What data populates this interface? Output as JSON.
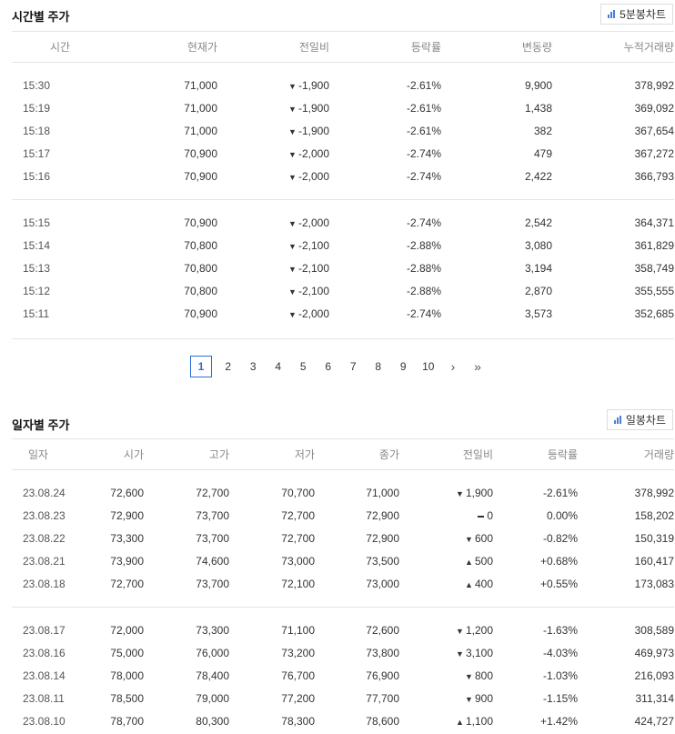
{
  "hourly": {
    "title": "시간별 주가",
    "chart_button": "5분봉차트",
    "columns": [
      "시간",
      "현재가",
      "전일비",
      "등락률",
      "변동량",
      "누적거래량"
    ],
    "group1": [
      {
        "time": "15:30",
        "price": "71,000",
        "dir": "down",
        "change": "-1,900",
        "rate": "-2.61%",
        "volume": "9,900",
        "cum": "378,992"
      },
      {
        "time": "15:19",
        "price": "71,000",
        "dir": "down",
        "change": "-1,900",
        "rate": "-2.61%",
        "volume": "1,438",
        "cum": "369,092"
      },
      {
        "time": "15:18",
        "price": "71,000",
        "dir": "down",
        "change": "-1,900",
        "rate": "-2.61%",
        "volume": "382",
        "cum": "367,654"
      },
      {
        "time": "15:17",
        "price": "70,900",
        "dir": "down",
        "change": "-2,000",
        "rate": "-2.74%",
        "volume": "479",
        "cum": "367,272"
      },
      {
        "time": "15:16",
        "price": "70,900",
        "dir": "down",
        "change": "-2,000",
        "rate": "-2.74%",
        "volume": "2,422",
        "cum": "366,793"
      }
    ],
    "group2": [
      {
        "time": "15:15",
        "price": "70,900",
        "dir": "down",
        "change": "-2,000",
        "rate": "-2.74%",
        "volume": "2,542",
        "cum": "364,371"
      },
      {
        "time": "15:14",
        "price": "70,800",
        "dir": "down",
        "change": "-2,100",
        "rate": "-2.88%",
        "volume": "3,080",
        "cum": "361,829"
      },
      {
        "time": "15:13",
        "price": "70,800",
        "dir": "down",
        "change": "-2,100",
        "rate": "-2.88%",
        "volume": "3,194",
        "cum": "358,749"
      },
      {
        "time": "15:12",
        "price": "70,800",
        "dir": "down",
        "change": "-2,100",
        "rate": "-2.88%",
        "volume": "2,870",
        "cum": "355,555"
      },
      {
        "time": "15:11",
        "price": "70,900",
        "dir": "down",
        "change": "-2,000",
        "rate": "-2.74%",
        "volume": "3,573",
        "cum": "352,685"
      }
    ]
  },
  "pagination": {
    "current": "1",
    "pages": [
      "2",
      "3",
      "4",
      "5",
      "6",
      "7",
      "8",
      "9",
      "10"
    ],
    "next": "›",
    "last": "»"
  },
  "daily": {
    "title": "일자별 주가",
    "chart_button": "일봉차트",
    "columns": [
      "일자",
      "시가",
      "고가",
      "저가",
      "종가",
      "전일비",
      "등락률",
      "거래량"
    ],
    "group1": [
      {
        "date": "23.08.24",
        "open": "72,600",
        "high": "72,700",
        "low": "70,700",
        "close": "71,000",
        "dir": "down",
        "change": "1,900",
        "rate": "-2.61%",
        "volume": "378,992"
      },
      {
        "date": "23.08.23",
        "open": "72,900",
        "high": "73,700",
        "low": "72,700",
        "close": "72,900",
        "dir": "flat",
        "change": "0",
        "rate": "0.00%",
        "volume": "158,202"
      },
      {
        "date": "23.08.22",
        "open": "73,300",
        "high": "73,700",
        "low": "72,700",
        "close": "72,900",
        "dir": "down",
        "change": "600",
        "rate": "-0.82%",
        "volume": "150,319"
      },
      {
        "date": "23.08.21",
        "open": "73,900",
        "high": "74,600",
        "low": "73,000",
        "close": "73,500",
        "dir": "up",
        "change": "500",
        "rate": "+0.68%",
        "volume": "160,417"
      },
      {
        "date": "23.08.18",
        "open": "72,700",
        "high": "73,700",
        "low": "72,100",
        "close": "73,000",
        "dir": "up",
        "change": "400",
        "rate": "+0.55%",
        "volume": "173,083"
      }
    ],
    "group2": [
      {
        "date": "23.08.17",
        "open": "72,000",
        "high": "73,300",
        "low": "71,100",
        "close": "72,600",
        "dir": "down",
        "change": "1,200",
        "rate": "-1.63%",
        "volume": "308,589"
      },
      {
        "date": "23.08.16",
        "open": "75,000",
        "high": "76,000",
        "low": "73,200",
        "close": "73,800",
        "dir": "down",
        "change": "3,100",
        "rate": "-4.03%",
        "volume": "469,973"
      },
      {
        "date": "23.08.14",
        "open": "78,000",
        "high": "78,400",
        "low": "76,700",
        "close": "76,900",
        "dir": "down",
        "change": "800",
        "rate": "-1.03%",
        "volume": "216,093"
      },
      {
        "date": "23.08.11",
        "open": "78,500",
        "high": "79,000",
        "low": "77,200",
        "close": "77,700",
        "dir": "down",
        "change": "900",
        "rate": "-1.15%",
        "volume": "311,314"
      },
      {
        "date": "23.08.10",
        "open": "78,700",
        "high": "80,300",
        "low": "78,300",
        "close": "78,600",
        "dir": "up",
        "change": "1,100",
        "rate": "+1.42%",
        "volume": "424,727"
      }
    ]
  },
  "colors": {
    "down": "#2a5fe0",
    "up": "#e41e1e",
    "accent": "#2a6fd6"
  }
}
